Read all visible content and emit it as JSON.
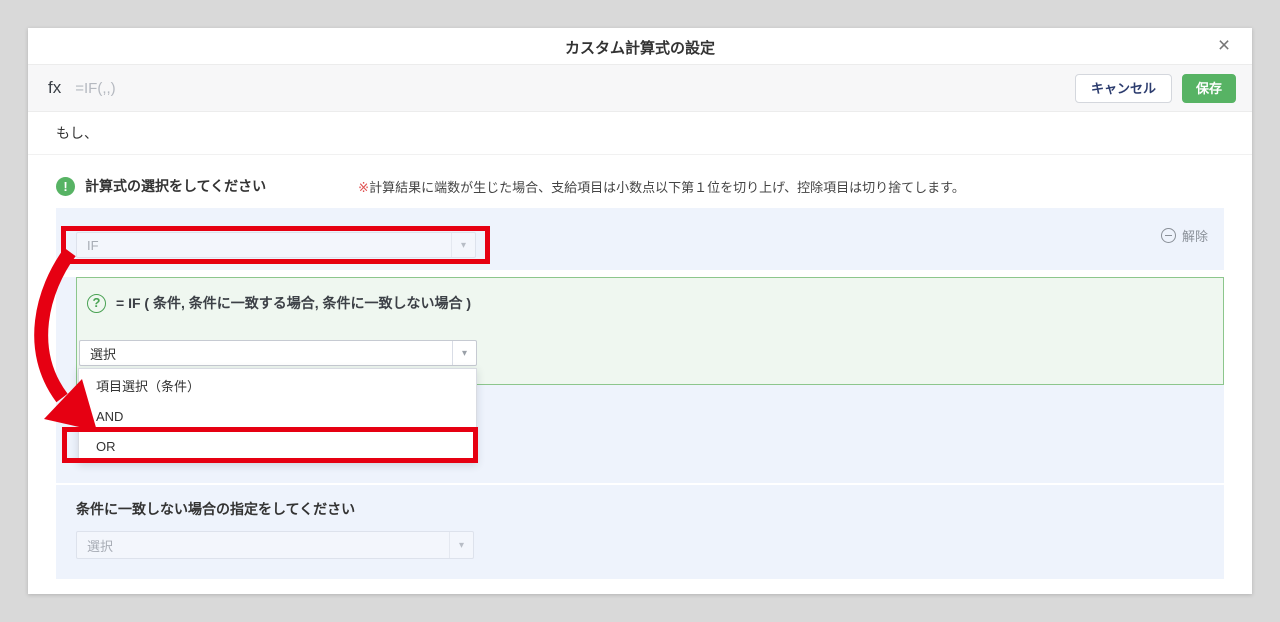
{
  "dialog": {
    "title": "カスタム計算式の設定"
  },
  "icons": {
    "close_glyph": "×",
    "caret_glyph": "▾",
    "info_glyph": "!",
    "help_glyph": "?"
  },
  "formula_bar": {
    "fx": "fx",
    "expression": "=IF(,,)",
    "cancel": "キャンセル",
    "save": "保存"
  },
  "rows": {
    "if_intro": "もし、"
  },
  "guide": {
    "heading": "計算式の選択をしてください",
    "note_mark": "※",
    "note_text": "計算結果に端数が生じた場合、支給項目は小数点以下第１位を切り上げ、控除項目は切り捨てします。"
  },
  "formula_section": {
    "function_value": "IF",
    "remove_label": "解除",
    "syntax_hint": "= IF ( 条件, 条件に一致する場合, 条件に一致しない場合 )",
    "select_placeholder": "選択",
    "options": [
      "項目選択（条件）",
      "AND",
      "OR"
    ],
    "highlighted_option": "OR"
  },
  "else_section": {
    "heading": "条件に一致しない場合の指定をしてください",
    "select_placeholder": "選択"
  },
  "colors": {
    "highlight_red": "#e60012",
    "save_green": "#57b364",
    "panel_blue": "#eef3fc",
    "hint_green_bg": "#eff7f0",
    "hint_green_border": "#8cc68c",
    "page_background": "#d9d9d9"
  }
}
